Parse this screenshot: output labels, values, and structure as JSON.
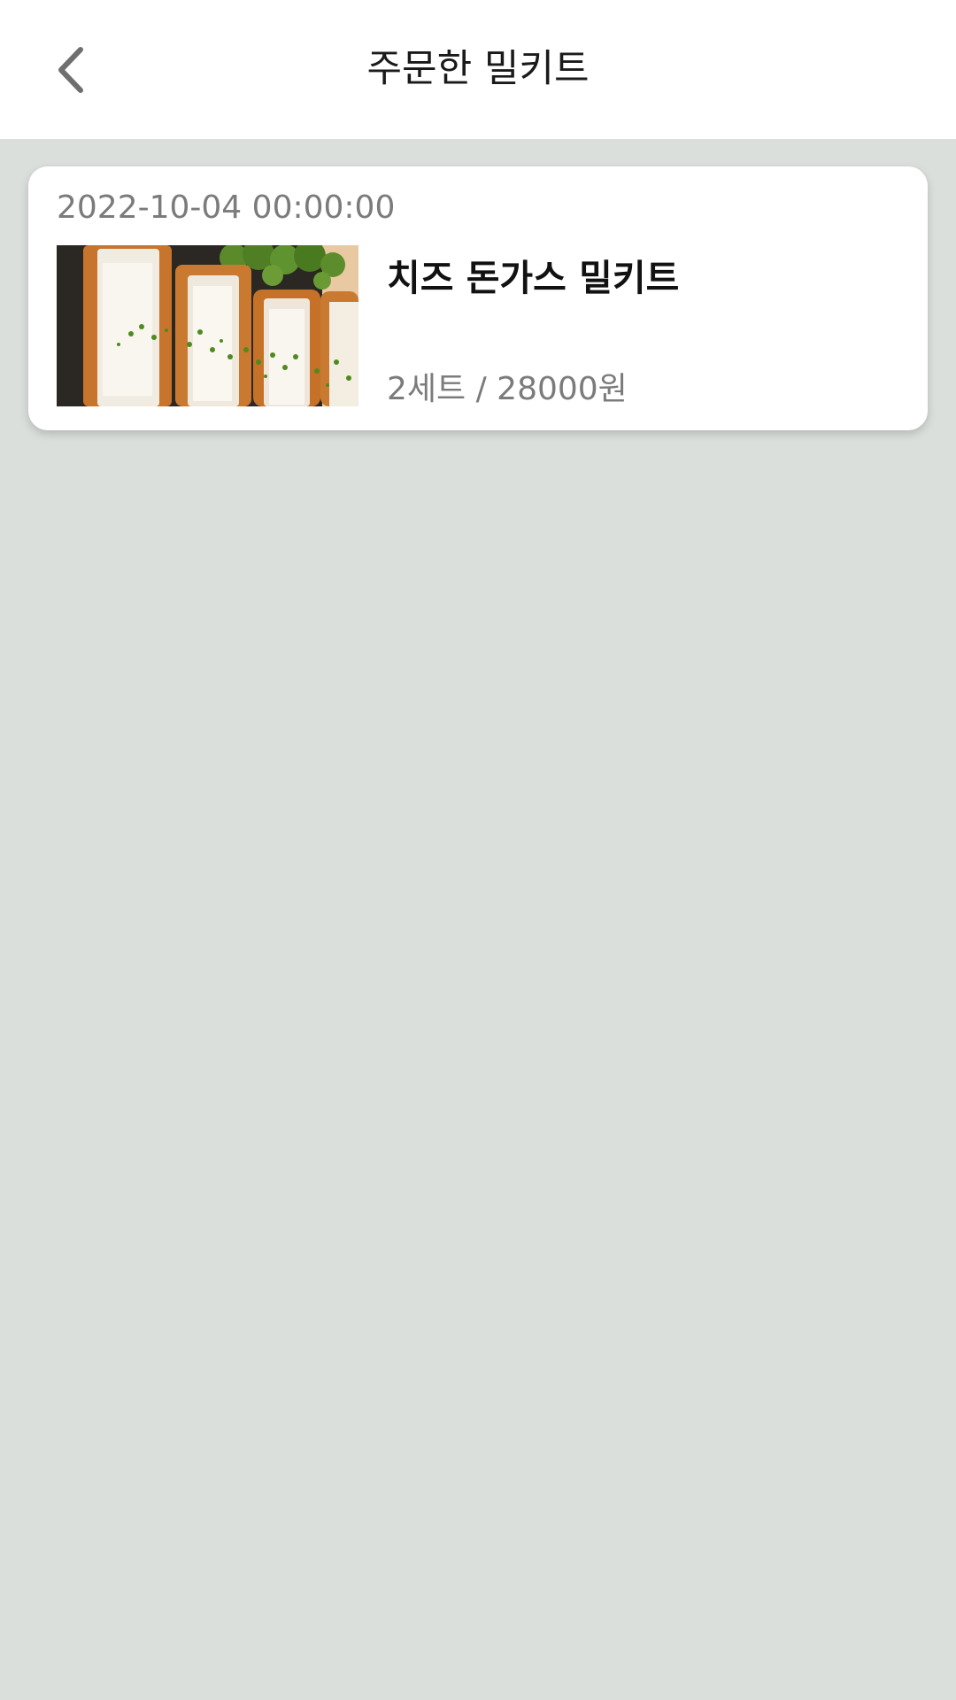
{
  "header": {
    "title": "주문한 밀키트",
    "back_icon": "chevron-left-icon"
  },
  "orders": [
    {
      "date": "2022-10-04 00:00:00",
      "product_name": "치즈 돈가스 밀키트",
      "quantity_price": "2세트 / 28000원"
    }
  ],
  "colors": {
    "background": "#dbdfdc",
    "header_bg": "#ffffff",
    "card_bg": "#ffffff",
    "secondary_text": "#7b7b7b",
    "primary_text": "#111111"
  }
}
